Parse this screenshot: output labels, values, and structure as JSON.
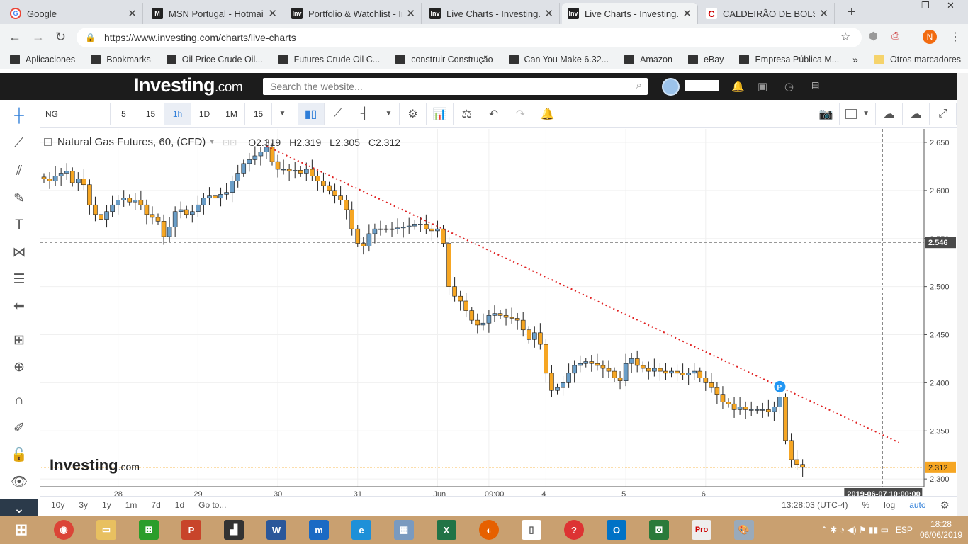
{
  "browser": {
    "tabs": [
      {
        "title": "Google",
        "fav": "G",
        "type": "g"
      },
      {
        "title": "MSN Portugal - Hotmail,",
        "fav": "M",
        "type": ""
      },
      {
        "title": "Portfolio & Watchlist - In",
        "fav": "Inv",
        "type": ""
      },
      {
        "title": "Live Charts - Investing.co",
        "fav": "Inv",
        "type": ""
      },
      {
        "title": "Live Charts - Investing.co",
        "fav": "Inv",
        "type": "active"
      },
      {
        "title": "CALDEIRÃO DE BOLSA -",
        "fav": "C",
        "type": "cal"
      }
    ],
    "url": "https://www.investing.com/charts/live-charts",
    "profile_initial": "N",
    "bookmarks": [
      {
        "label": "Aplicaciones",
        "icon": "apps-icon"
      },
      {
        "label": "Bookmarks",
        "icon": "star-icon"
      },
      {
        "label": "Oil Price  Crude Oil...",
        "icon": "investing-icon"
      },
      {
        "label": "Futures Crude Oil C...",
        "icon": "facebook-icon"
      },
      {
        "label": "construir Construção",
        "icon": "c-icon"
      },
      {
        "label": "Can You Make 6.32...",
        "icon": "globe-icon"
      },
      {
        "label": "Amazon",
        "icon": "amazon-icon"
      },
      {
        "label": "eBay",
        "icon": "globe-icon"
      },
      {
        "label": "Empresa Pública M...",
        "icon": "globe-icon"
      }
    ],
    "bookmarks_more": "»",
    "other_bookmarks": "Otros marcadores"
  },
  "site": {
    "logo_main": "Investing",
    "logo_suffix": ".com",
    "search_placeholder": "Search the website..."
  },
  "toolbar": {
    "symbol": "NG",
    "intervals": [
      "5",
      "15",
      "1h",
      "1D",
      "1M",
      "15"
    ],
    "active_interval": "1h"
  },
  "chart_data": {
    "type": "candlestick",
    "title": "Natural Gas Futures, 60, (CFD)",
    "ohlc": {
      "O": "2.319",
      "H": "2.319",
      "L": "2.305",
      "C": "2.312"
    },
    "yticks": [
      "2.650",
      "2.600",
      "2.550",
      "2.500",
      "2.450",
      "2.400",
      "2.350",
      "2.300"
    ],
    "ylim": [
      2.292,
      2.664
    ],
    "xticks": [
      {
        "label": "28",
        "i": 13
      },
      {
        "label": "29",
        "i": 27
      },
      {
        "label": "30",
        "i": 41
      },
      {
        "label": "31",
        "i": 55
      },
      {
        "label": "Jun",
        "i": 69
      },
      {
        "label": "09:00",
        "i": 78
      },
      {
        "label": "4",
        "i": 88
      },
      {
        "label": "5",
        "i": 102
      },
      {
        "label": "6",
        "i": 116
      }
    ],
    "crosshair_price": "2.546",
    "last_price": "2.312",
    "crosshair_time": "2019-06-07 10:00:00",
    "marker": "P",
    "colors": {
      "up": "#6a9ec8",
      "down": "#f6a623",
      "trend": "#e02020",
      "lastline": "#f6a623"
    },
    "closes": [
      2.612,
      2.61,
      2.615,
      2.618,
      2.62,
      2.608,
      2.612,
      2.606,
      2.585,
      2.575,
      2.57,
      2.578,
      2.585,
      2.59,
      2.592,
      2.588,
      2.59,
      2.585,
      2.575,
      2.572,
      2.568,
      2.552,
      2.562,
      2.578,
      2.58,
      2.575,
      2.578,
      2.585,
      2.592,
      2.595,
      2.592,
      2.596,
      2.598,
      2.61,
      2.618,
      2.628,
      2.632,
      2.636,
      2.64,
      2.645,
      2.63,
      2.622,
      2.622,
      2.62,
      2.621,
      2.618,
      2.622,
      2.615,
      2.61,
      2.605,
      2.6,
      2.595,
      2.59,
      2.58,
      2.56,
      2.545,
      2.542,
      2.555,
      2.56,
      2.56,
      2.56,
      2.56,
      2.561,
      2.562,
      2.563,
      2.565,
      2.565,
      2.56,
      2.558,
      2.56,
      2.545,
      2.5,
      2.49,
      2.485,
      2.475,
      2.465,
      2.46,
      2.462,
      2.47,
      2.472,
      2.47,
      2.468,
      2.467,
      2.465,
      2.455,
      2.445,
      2.452,
      2.44,
      2.41,
      2.392,
      2.395,
      2.4,
      2.41,
      2.418,
      2.42,
      2.422,
      2.42,
      2.418,
      2.415,
      2.412,
      2.405,
      2.402,
      2.42,
      2.425,
      2.418,
      2.415,
      2.412,
      2.415,
      2.412,
      2.41,
      2.412,
      2.41,
      2.408,
      2.41,
      2.412,
      2.405,
      2.4,
      2.395,
      2.388,
      2.38,
      2.378,
      2.372,
      2.375,
      2.372,
      2.372,
      2.372,
      2.372,
      2.37,
      2.375,
      2.385,
      2.34,
      2.32,
      2.315,
      2.312
    ]
  },
  "bottom": {
    "ranges": [
      "10y",
      "3y",
      "1y",
      "1m",
      "7d",
      "1d"
    ],
    "goto": "Go to...",
    "time": "13:28:03 (UTC-4)",
    "pct": "%",
    "log": "log",
    "auto": "auto"
  },
  "watermark": {
    "main": "Investing",
    "suffix": ".com"
  },
  "taskbar": {
    "lang": "ESP",
    "time": "18:28",
    "date": "06/06/2019"
  }
}
